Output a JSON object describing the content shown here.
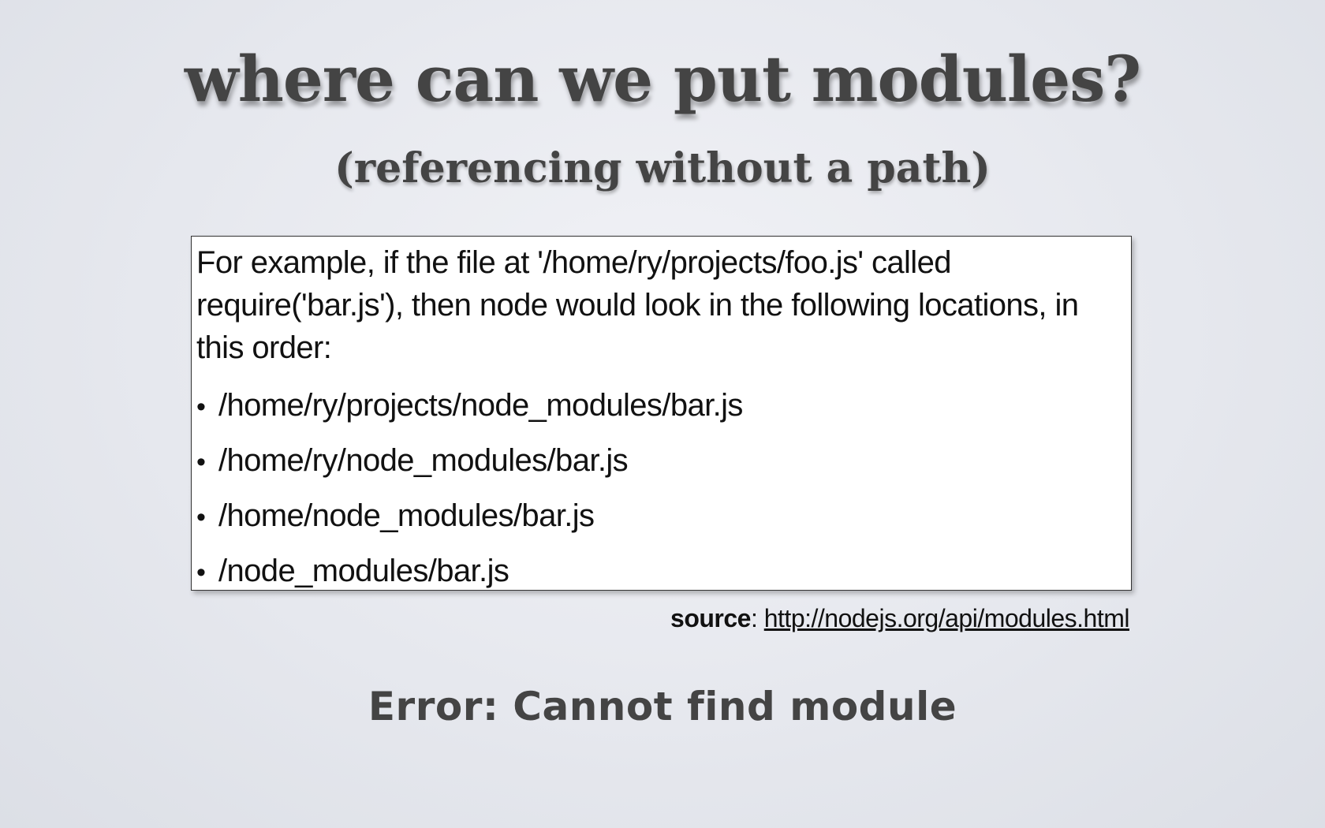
{
  "slide": {
    "title": "where can we put modules?",
    "subtitle": "(referencing without a path)",
    "quote": {
      "intro": "For example, if the file at '/home/ry/projects/foo.js' called require('bar.js'), then node would look in the following locations, in this order:",
      "bullet_glyph": "•",
      "paths": [
        "/home/ry/projects/node_modules/bar.js",
        "/home/ry/node_modules/bar.js",
        "/home/node_modules/bar.js",
        "/node_modules/bar.js"
      ]
    },
    "source": {
      "label": "source",
      "separator": ": ",
      "link_text": "http://nodejs.org/api/modules.html"
    },
    "error_text": "Error: Cannot find module"
  }
}
